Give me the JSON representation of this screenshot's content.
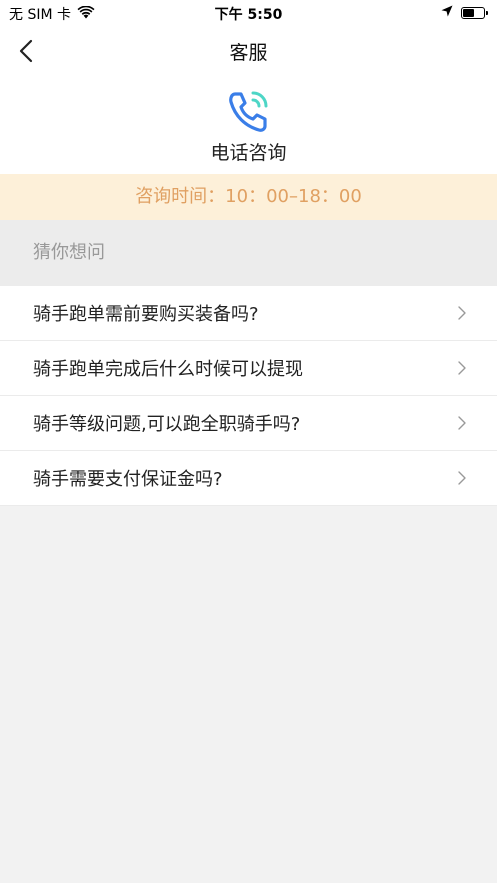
{
  "status_bar": {
    "carrier": "无 SIM 卡",
    "time": "下午 5:50"
  },
  "nav": {
    "title": "客服"
  },
  "phone": {
    "label": "电话咨询",
    "icon": "phone-call-icon",
    "colors": {
      "handset": "#3a7ee8",
      "waves": "#4dd6c6"
    }
  },
  "hours": {
    "text": "咨询时间：10：00–18：00"
  },
  "faq": {
    "section_title": "猜你想问",
    "items": [
      {
        "text": "骑手跑单需前要购买装备吗?"
      },
      {
        "text": "骑手跑单完成后什么时候可以提现"
      },
      {
        "text": "骑手等级问题,可以跑全职骑手吗?"
      },
      {
        "text": "骑手需要支付保证金吗?"
      }
    ]
  }
}
